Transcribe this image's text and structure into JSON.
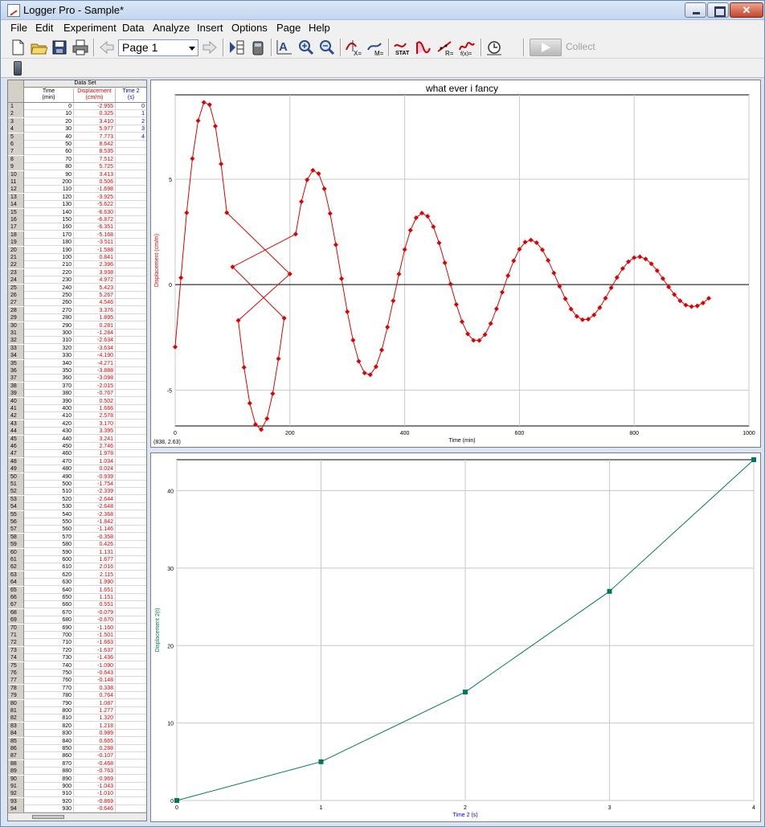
{
  "window": {
    "title": "Logger Pro - Sample*"
  },
  "menu": [
    "File",
    "Edit",
    "Experiment",
    "Data",
    "Analyze",
    "Insert",
    "Options",
    "Page",
    "Help"
  ],
  "toolbar": {
    "page_value": "Page 1",
    "collect_label": "Collect"
  },
  "table": {
    "dataset_title": "Data Set",
    "columns": [
      {
        "name": "Time",
        "unit": "(min)"
      },
      {
        "name": "Displacement",
        "unit": "(cm/m)"
      },
      {
        "name": "Time 2",
        "unit": "(s)"
      }
    ],
    "rows": [
      [
        1,
        0,
        "-2.955",
        "0"
      ],
      [
        2,
        10,
        "0.325",
        "1"
      ],
      [
        3,
        20,
        "3.410",
        "2"
      ],
      [
        4,
        30,
        "5.977",
        "3"
      ],
      [
        5,
        40,
        "7.773",
        "4"
      ],
      [
        6,
        50,
        "8.642",
        ""
      ],
      [
        7,
        60,
        "8.535",
        ""
      ],
      [
        8,
        70,
        "7.512",
        ""
      ],
      [
        9,
        80,
        "5.725",
        ""
      ],
      [
        10,
        90,
        "3.413",
        ""
      ],
      [
        11,
        200,
        "0.506",
        ""
      ],
      [
        12,
        110,
        "-1.698",
        ""
      ],
      [
        13,
        120,
        "-3.925",
        ""
      ],
      [
        14,
        130,
        "-5.622",
        ""
      ],
      [
        15,
        140,
        "-6.630",
        ""
      ],
      [
        16,
        150,
        "-6.872",
        ""
      ],
      [
        17,
        160,
        "-6.351",
        ""
      ],
      [
        18,
        170,
        "-5.168",
        ""
      ],
      [
        19,
        180,
        "-3.511",
        ""
      ],
      [
        20,
        190,
        "-1.588",
        ""
      ],
      [
        21,
        100,
        "0.841",
        ""
      ],
      [
        22,
        210,
        "2.396",
        ""
      ],
      [
        23,
        220,
        "3.938",
        ""
      ],
      [
        24,
        230,
        "4.972",
        ""
      ],
      [
        25,
        240,
        "5.423",
        ""
      ],
      [
        26,
        250,
        "5.267",
        ""
      ],
      [
        27,
        260,
        "4.546",
        ""
      ],
      [
        28,
        270,
        "3.376",
        ""
      ],
      [
        29,
        280,
        "1.895",
        ""
      ],
      [
        30,
        290,
        "0.281",
        ""
      ],
      [
        31,
        300,
        "-1.284",
        ""
      ],
      [
        32,
        310,
        "-2.634",
        ""
      ],
      [
        33,
        320,
        "-3.634",
        ""
      ],
      [
        34,
        330,
        "-4.190",
        ""
      ],
      [
        35,
        340,
        "-4.271",
        ""
      ],
      [
        36,
        350,
        "-3.888",
        ""
      ],
      [
        37,
        360,
        "-3.098",
        ""
      ],
      [
        38,
        370,
        "-2.015",
        ""
      ],
      [
        39,
        380,
        "-0.767",
        ""
      ],
      [
        40,
        390,
        "0.502",
        ""
      ],
      [
        41,
        400,
        "1.666",
        ""
      ],
      [
        42,
        410,
        "2.578",
        ""
      ],
      [
        43,
        420,
        "3.170",
        ""
      ],
      [
        44,
        430,
        "3.395",
        ""
      ],
      [
        45,
        440,
        "3.241",
        ""
      ],
      [
        46,
        450,
        "2.746",
        ""
      ],
      [
        47,
        460,
        "1.978",
        ""
      ],
      [
        48,
        470,
        "1.034",
        ""
      ],
      [
        49,
        480,
        "0.024",
        ""
      ],
      [
        50,
        490,
        "-0.939",
        ""
      ],
      [
        51,
        500,
        "-1.754",
        ""
      ],
      [
        52,
        510,
        "-2.339",
        ""
      ],
      [
        53,
        520,
        "-2.644",
        ""
      ],
      [
        54,
        530,
        "-2.648",
        ""
      ],
      [
        55,
        540,
        "-2.368",
        ""
      ],
      [
        56,
        550,
        "-1.842",
        ""
      ],
      [
        57,
        560,
        "-1.146",
        ""
      ],
      [
        58,
        570,
        "-0.358",
        ""
      ],
      [
        59,
        580,
        "0.426",
        ""
      ],
      [
        60,
        590,
        "1.131",
        ""
      ],
      [
        61,
        600,
        "1.677",
        ""
      ],
      [
        62,
        610,
        "2.016",
        ""
      ],
      [
        63,
        620,
        "2.115",
        ""
      ],
      [
        64,
        630,
        "1.990",
        ""
      ],
      [
        65,
        640,
        "1.651",
        ""
      ],
      [
        66,
        650,
        "1.151",
        ""
      ],
      [
        67,
        660,
        "0.551",
        ""
      ],
      [
        68,
        670,
        "-0.079",
        ""
      ],
      [
        69,
        680,
        "-0.670",
        ""
      ],
      [
        70,
        690,
        "-1.160",
        ""
      ],
      [
        71,
        700,
        "-1.501",
        ""
      ],
      [
        72,
        710,
        "-1.663",
        ""
      ],
      [
        73,
        720,
        "-1.637",
        ""
      ],
      [
        74,
        730,
        "-1.436",
        ""
      ],
      [
        75,
        740,
        "-1.090",
        ""
      ],
      [
        76,
        750,
        "-0.643",
        ""
      ],
      [
        77,
        760,
        "-0.148",
        ""
      ],
      [
        78,
        770,
        "0.338",
        ""
      ],
      [
        79,
        780,
        "0.764",
        ""
      ],
      [
        80,
        790,
        "1.087",
        ""
      ],
      [
        81,
        800,
        "1.277",
        ""
      ],
      [
        82,
        810,
        "1.320",
        ""
      ],
      [
        83,
        820,
        "1.218",
        ""
      ],
      [
        84,
        830,
        "0.989",
        ""
      ],
      [
        85,
        840,
        "0.665",
        ""
      ],
      [
        86,
        850,
        "0.288",
        ""
      ],
      [
        87,
        860,
        "-0.107",
        ""
      ],
      [
        88,
        870,
        "-0.468",
        ""
      ],
      [
        89,
        880,
        "-0.763",
        ""
      ],
      [
        90,
        890,
        "-0.969",
        ""
      ],
      [
        91,
        900,
        "-1.043",
        ""
      ],
      [
        92,
        910,
        "-1.010",
        ""
      ],
      [
        93,
        920,
        "-0.869",
        ""
      ],
      [
        94,
        930,
        "-0.646",
        ""
      ]
    ]
  },
  "graph1": {
    "coord_readout": "(838, 2.63)"
  },
  "graph2": {},
  "chart_data": [
    {
      "type": "line",
      "title": "what ever i fancy",
      "xlabel": "Time (min)",
      "ylabel": "Displacement (cm/m)",
      "xlim": [
        0,
        1000
      ],
      "ylim": [
        -6.7,
        9.0
      ],
      "xticks": [
        0,
        200,
        400,
        600,
        800,
        1000
      ],
      "yticks": [
        -5,
        0,
        5
      ],
      "color": "#e00000",
      "x_source": "table.rows[1]",
      "y_source": "table.rows[2]"
    },
    {
      "type": "line",
      "xlabel": "Time 2 (s)",
      "ylabel": "Displacement 2(t)",
      "xlim": [
        0,
        4
      ],
      "ylim": [
        0,
        44
      ],
      "xticks": [
        0,
        1,
        2,
        3,
        4
      ],
      "yticks": [
        0,
        10,
        20,
        30,
        40
      ],
      "color": "#00785a",
      "x": [
        0,
        1,
        2,
        3,
        4
      ],
      "y": [
        0,
        5,
        14,
        27,
        44
      ]
    }
  ]
}
